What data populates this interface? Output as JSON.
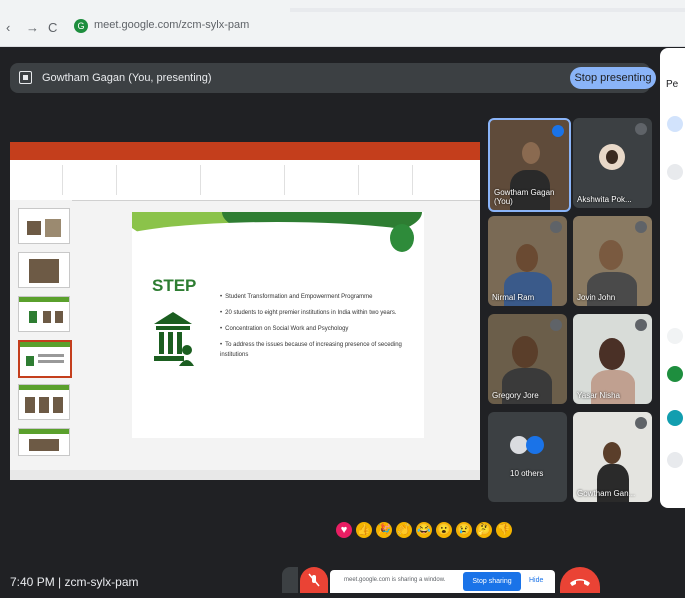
{
  "browser": {
    "back_icon": "back-arrow-icon",
    "forward_glyph": "→",
    "reload_glyph": "C",
    "url": "meet.google.com/zcm-sylx-pam"
  },
  "present_bar": {
    "label": "Gowtham Gagan (You, presenting)",
    "stop_button": "Stop presenting"
  },
  "slide": {
    "title": "STEP",
    "bullets": [
      "Student Transformation and Empowerment Programme",
      "20 students to eight premier institutions in India within two years.",
      "Concentration on Social Work and Psychology",
      "To address the issues because of increasing presence of seceding institutions"
    ]
  },
  "participants": [
    {
      "name": "Gowtham Gagan (You)",
      "color": "#5f4b3a"
    },
    {
      "name": "Akshwita Pok...",
      "color": "#3c4043"
    },
    {
      "name": "Nirmal Ram",
      "color": "#7a6a55"
    },
    {
      "name": "Jovin John",
      "color": "#8a7a62"
    },
    {
      "name": "Gregory Jore",
      "color": "#6b5e4a"
    },
    {
      "name": "Yasar Nisha",
      "color": "#d8dcd8"
    },
    {
      "name": "10 others",
      "color": "#3c4043"
    },
    {
      "name": "Gowtham Gan...",
      "color": "#e4e4e0"
    }
  ],
  "reactions": [
    {
      "glyph": "♥",
      "color": "#e91e63"
    },
    {
      "glyph": "👍",
      "color": "#f4b400"
    },
    {
      "glyph": "🎉",
      "color": "#f4b400"
    },
    {
      "glyph": "👏",
      "color": "#f4b400"
    },
    {
      "glyph": "😂",
      "color": "#f4b400"
    },
    {
      "glyph": "😮",
      "color": "#f4b400"
    },
    {
      "glyph": "😢",
      "color": "#f4b400"
    },
    {
      "glyph": "🤔",
      "color": "#f4b400"
    },
    {
      "glyph": "👎",
      "color": "#f4b400"
    }
  ],
  "bottom": {
    "clock": "7:40 PM",
    "separator": "|",
    "meeting_code": "zcm-sylx-pam"
  },
  "share_banner": {
    "text": "meet.google.com is sharing a window.",
    "stop_button": "Stop sharing",
    "hide_button": "Hide"
  },
  "panel": {
    "title_fragment": "Pe"
  },
  "colors": {
    "meet_bg": "#202124",
    "accent_blue": "#8ab4f8",
    "ppt_orange": "#c43e1c",
    "slide_green": "#2e7d32",
    "end_call_red": "#ea4335"
  }
}
